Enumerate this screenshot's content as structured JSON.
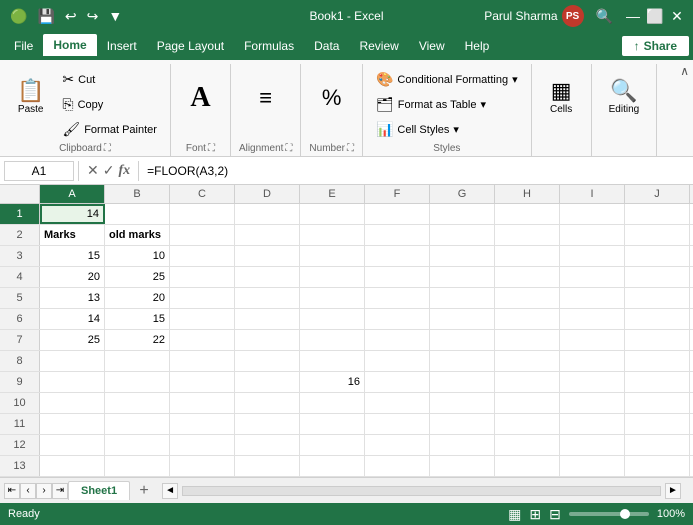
{
  "titleBar": {
    "title": "Book1 - Excel",
    "qatIcons": [
      "💾",
      "↩",
      "↪",
      "▼"
    ],
    "user": "Parul Sharma",
    "userInitials": "PS",
    "searchPlaceholder": "🔍",
    "winButtons": [
      "—",
      "⬜",
      "✕"
    ]
  },
  "menuBar": {
    "items": [
      "File",
      "Home",
      "Insert",
      "Page Layout",
      "Formulas",
      "Data",
      "Review",
      "View",
      "Help"
    ],
    "activeItem": "Home",
    "shareLabel": "Share"
  },
  "ribbon": {
    "groups": [
      {
        "name": "Clipboard",
        "items": [
          "Paste",
          "Cut",
          "Copy",
          "Format Painter"
        ]
      },
      {
        "name": "Font",
        "items": [
          "Font"
        ]
      },
      {
        "name": "Alignment",
        "items": [
          "Alignment"
        ]
      },
      {
        "name": "Number",
        "items": [
          "Number"
        ]
      },
      {
        "name": "Styles",
        "items": [
          "Conditional Formatting",
          "Format as Table",
          "Cell Styles"
        ]
      },
      {
        "name": "Cells",
        "items": [
          "Cells"
        ]
      },
      {
        "name": "Editing",
        "items": [
          "Editing"
        ]
      }
    ],
    "conditionalFormatting": "Conditional Formatting",
    "formatTable": "Format as Table",
    "cellStyles": "Cell Styles",
    "cells": "Cells",
    "editing": "Editing",
    "font": "Font",
    "alignment": "Alignment",
    "number": "Number",
    "clipboard": "Clipboard",
    "paste": "Paste"
  },
  "formulaBar": {
    "cellRef": "A1",
    "formula": "=FLOOR(A3,2)",
    "icons": [
      "✕",
      "✓",
      "fx"
    ]
  },
  "columns": [
    "A",
    "B",
    "C",
    "D",
    "E",
    "F",
    "G",
    "H",
    "I",
    "J"
  ],
  "rows": [
    {
      "num": 1,
      "cells": [
        {
          "val": "14",
          "right": true
        },
        "",
        "",
        "",
        "",
        "",
        "",
        "",
        "",
        ""
      ]
    },
    {
      "num": 2,
      "cells": [
        {
          "val": "Marks",
          "bold": true
        },
        {
          "val": "old marks",
          "bold": true
        },
        "",
        "",
        "",
        "",
        "",
        "",
        "",
        ""
      ]
    },
    {
      "num": 3,
      "cells": [
        {
          "val": "15",
          "right": true
        },
        {
          "val": "10",
          "right": true
        },
        "",
        "",
        "",
        "",
        "",
        "",
        "",
        ""
      ]
    },
    {
      "num": 4,
      "cells": [
        {
          "val": "20",
          "right": true
        },
        {
          "val": "25",
          "right": true
        },
        "",
        "",
        "",
        "",
        "",
        "",
        "",
        ""
      ]
    },
    {
      "num": 5,
      "cells": [
        {
          "val": "13",
          "right": true
        },
        {
          "val": "20",
          "right": true
        },
        "",
        "",
        "",
        "",
        "",
        "",
        "",
        ""
      ]
    },
    {
      "num": 6,
      "cells": [
        {
          "val": "14",
          "right": true
        },
        {
          "val": "15",
          "right": true
        },
        "",
        "",
        "",
        "",
        "",
        "",
        "",
        ""
      ]
    },
    {
      "num": 7,
      "cells": [
        {
          "val": "25",
          "right": true
        },
        {
          "val": "22",
          "right": true
        },
        "",
        "",
        "",
        "",
        "",
        "",
        "",
        ""
      ]
    },
    {
      "num": 8,
      "cells": [
        "",
        "",
        "",
        "",
        "",
        "",
        "",
        "",
        "",
        ""
      ]
    },
    {
      "num": 9,
      "cells": [
        "",
        "",
        "",
        {
          "val": ""
        },
        {
          "val": "16",
          "right": true
        },
        "",
        "",
        "",
        "",
        ""
      ]
    },
    {
      "num": 10,
      "cells": [
        "",
        "",
        "",
        "",
        "",
        "",
        "",
        "",
        "",
        ""
      ]
    },
    {
      "num": 11,
      "cells": [
        "",
        "",
        "",
        "",
        "",
        "",
        "",
        "",
        "",
        ""
      ]
    },
    {
      "num": 12,
      "cells": [
        "",
        "",
        "",
        "",
        "",
        "",
        "",
        "",
        "",
        ""
      ]
    },
    {
      "num": 13,
      "cells": [
        "",
        "",
        "",
        "",
        "",
        "",
        "",
        "",
        "",
        ""
      ]
    }
  ],
  "sheetTabs": [
    "Sheet1"
  ],
  "statusBar": {
    "status": "Ready",
    "zoom": "100%"
  }
}
